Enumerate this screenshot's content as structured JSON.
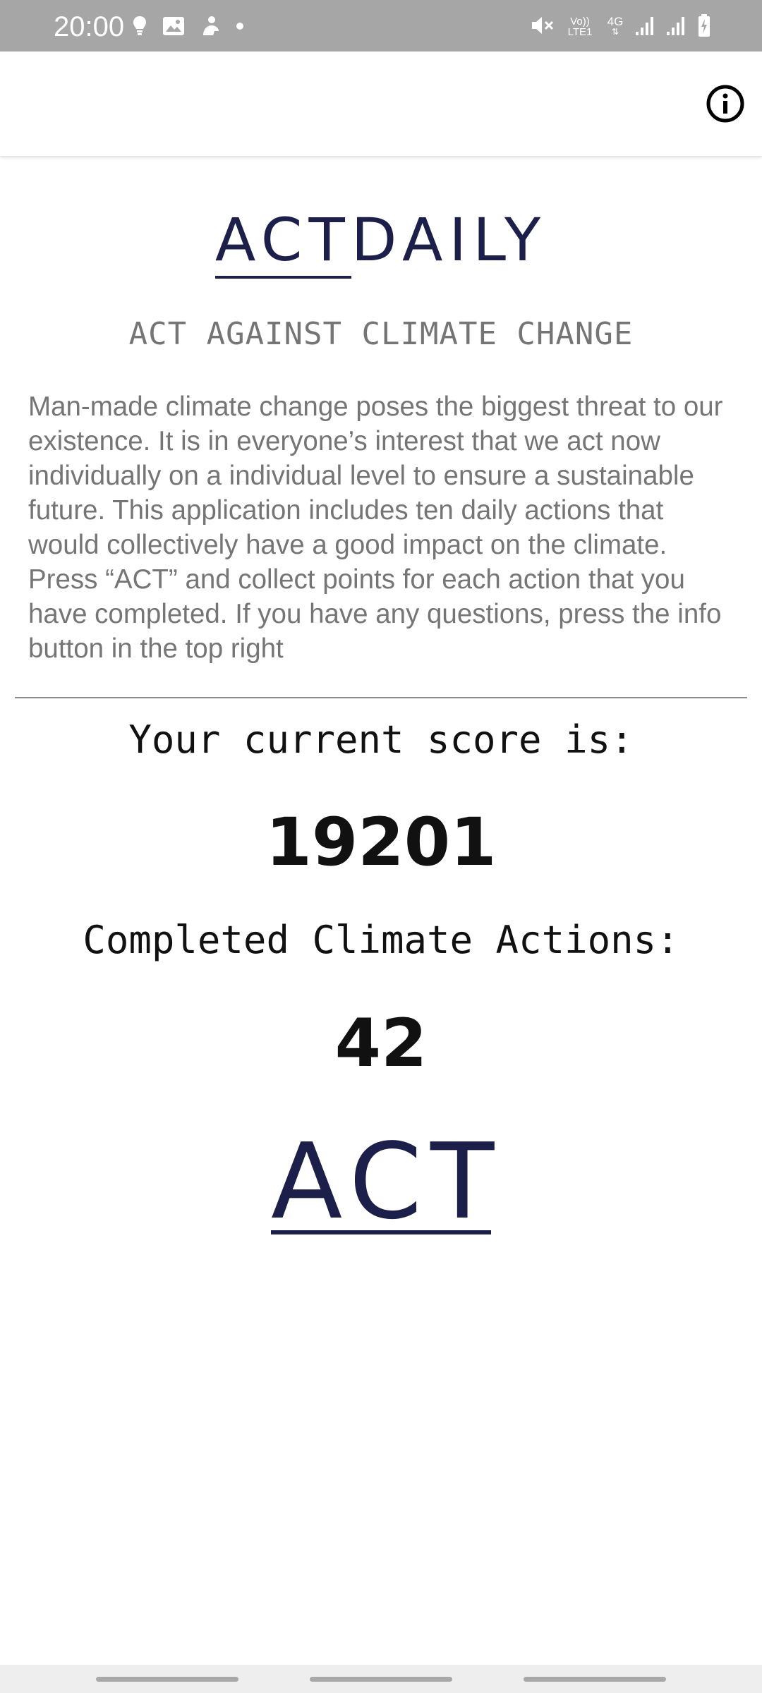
{
  "status_bar": {
    "time": "20:00",
    "left_icons": [
      "lightbulb-icon",
      "image-icon",
      "person-icon",
      "dot-icon"
    ],
    "right_icons": [
      "mute-icon",
      "volte-icon",
      "4g-icon",
      "signal-icon",
      "signal-icon-2",
      "battery-charging-icon"
    ],
    "volte_line1": "Vo))",
    "volte_line2": "LTE1",
    "network_label": "4G"
  },
  "app_bar": {
    "info_icon": "info-icon"
  },
  "logo": {
    "part1": "ACT",
    "part2": "DAILY"
  },
  "subtitle": "ACT AGAINST CLIMATE CHANGE",
  "description": "Man-made climate change poses the biggest threat to our existence. It is in everyone’s interest that we act now individually on a individual level to ensure a sustainable future. This application includes ten daily actions that would collectively have a good impact on the climate. Press “ACT” and collect points for each action that you have completed. If you have any questions, press the info button in the top right",
  "score": {
    "label": "Your current score is:",
    "value": "19201"
  },
  "actions": {
    "label": "Completed Climate Actions:",
    "value": "42"
  },
  "act_button": {
    "label": "ACT"
  },
  "colors": {
    "brand_navy": "#1c1f4a",
    "status_bar": "#a6a6a6",
    "muted_text": "#757575"
  }
}
